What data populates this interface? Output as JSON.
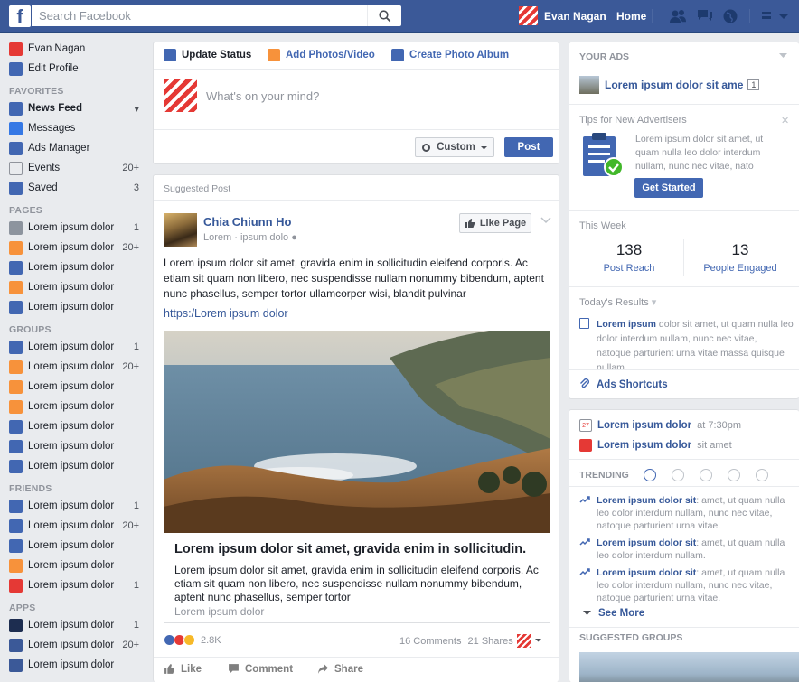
{
  "topbar": {
    "logo": "f",
    "search_placeholder": "Search Facebook",
    "user_name": "Evan Nagan",
    "home_label": "Home"
  },
  "leftnav": {
    "profile": [
      {
        "label": "Evan Nagan",
        "icon": "avatar-icon",
        "color": "#e53935"
      },
      {
        "label": "Edit Profile",
        "icon": "pencil-icon",
        "color": "#4267b2"
      }
    ],
    "sections": [
      {
        "title": "FAVORITES",
        "items": [
          {
            "label": "News Feed",
            "count": "",
            "icon": "news-feed-icon",
            "color": "#4267b2",
            "bold": true,
            "caret": true
          },
          {
            "label": "Messages",
            "count": "",
            "icon": "messages-icon",
            "color": "#3578e5"
          },
          {
            "label": "Ads Manager",
            "count": "",
            "icon": "ads-manager-icon",
            "color": "#4267b2"
          },
          {
            "label": "Events",
            "count": "20+",
            "icon": "calendar-icon",
            "color": "#e9ebee"
          },
          {
            "label": "Saved",
            "count": "3",
            "icon": "bookmark-icon",
            "color": "#4267b2"
          }
        ]
      },
      {
        "title": "PAGES",
        "items": [
          {
            "label": "Lorem ipsum dolor",
            "count": "1",
            "icon": "page-icon",
            "color": "#8d949e"
          },
          {
            "label": "Lorem ipsum dolor",
            "count": "20+",
            "icon": "megaphone-icon",
            "color": "#f7923b"
          },
          {
            "label": "Lorem ipsum dolor",
            "count": "",
            "icon": "thumbs-up-icon",
            "color": "#4267b2"
          },
          {
            "label": "Lorem ipsum dolor",
            "count": "",
            "icon": "plus-page-icon",
            "color": "#f7923b"
          },
          {
            "label": "Lorem ipsum dolor",
            "count": "",
            "icon": "chart-icon",
            "color": "#4267b2"
          }
        ]
      },
      {
        "title": "GROUPS",
        "items": [
          {
            "label": "Lorem ipsum dolor",
            "count": "1",
            "icon": "group-icon",
            "color": "#4267b2"
          },
          {
            "label": "Lorem ipsum dolor",
            "count": "20+",
            "icon": "group-icon",
            "color": "#f7923b"
          },
          {
            "label": "Lorem ipsum dolor",
            "count": "",
            "icon": "group-icon",
            "color": "#f7923b"
          },
          {
            "label": "Lorem ipsum dolor",
            "count": "",
            "icon": "group-icon",
            "color": "#f7923b"
          },
          {
            "label": "Lorem ipsum dolor",
            "count": "",
            "icon": "group-icon",
            "color": "#4267b2"
          },
          {
            "label": "Lorem ipsum dolor",
            "count": "",
            "icon": "group-icon",
            "color": "#4267b2"
          },
          {
            "label": "Lorem ipsum dolor",
            "count": "",
            "icon": "plus-group-icon",
            "color": "#4267b2"
          }
        ]
      },
      {
        "title": "FRIENDS",
        "items": [
          {
            "label": "Lorem ipsum dolor",
            "count": "1",
            "icon": "friends-icon",
            "color": "#4267b2"
          },
          {
            "label": "Lorem ipsum dolor",
            "count": "20+",
            "icon": "star-icon",
            "color": "#4267b2"
          },
          {
            "label": "Lorem ipsum dolor",
            "count": "",
            "icon": "friends-icon",
            "color": "#4267b2"
          },
          {
            "label": "Lorem ipsum dolor",
            "count": "",
            "icon": "home-icon",
            "color": "#f7923b"
          },
          {
            "label": "Lorem ipsum dolor",
            "count": "1",
            "icon": "location-icon",
            "color": "#e53935"
          }
        ]
      },
      {
        "title": "APPS",
        "items": [
          {
            "label": "Lorem ipsum dolor",
            "count": "1",
            "icon": "app-icon",
            "color": "#1d2d50"
          },
          {
            "label": "Lorem ipsum dolor",
            "count": "20+",
            "icon": "app-icon",
            "color": "#3b5998"
          },
          {
            "label": "Lorem ipsum dolor",
            "count": "",
            "icon": "app-icon",
            "color": "#3b5998"
          }
        ]
      }
    ]
  },
  "composer": {
    "tabs": [
      {
        "label": "Update Status",
        "icon": "pencil-icon",
        "color": "#4267b2"
      },
      {
        "label": "Add Photos/Video",
        "icon": "photo-icon",
        "color": "#f7923b"
      },
      {
        "label": "Create Photo Album",
        "icon": "album-icon",
        "color": "#4267b2"
      }
    ],
    "placeholder": "What's on your mind?",
    "audience_label": "Custom",
    "post_label": "Post"
  },
  "post": {
    "label": "Suggested Post",
    "author": "Chia Chiunn Ho",
    "subtitle": "Lorem · ipsum dolo",
    "like_page_label": "Like Page",
    "text": "Lorem ipsum dolor sit amet, gravida enim in sollicitudin eleifend corporis. Ac etiam sit quam non libero, nec suspendisse nullam nonummy bibendum, aptent nunc phasellus, semper tortor ullamcorper wisi, blandit pulvinar",
    "link": "https:/Lorem ipsum dolor",
    "link_title": "Lorem ipsum dolor sit amet, gravida enim in sollicitudin.",
    "link_desc": "Lorem ipsum dolor sit amet, gravida enim in sollicitudin eleifend corporis. Ac etiam sit quam non libero, nec suspendisse nullam nonummy bibendum, aptent nunc phasellus, semper tortor",
    "link_site": "Lorem ipsum dolor",
    "reaction_count": "2.8K",
    "comments": "16 Comments",
    "shares": "21 Shares",
    "actions": {
      "like": "Like",
      "comment": "Comment",
      "share": "Share"
    }
  },
  "ads": {
    "title": "YOUR ADS",
    "ad_title": "Lorem ipsum dolor sit ame",
    "ad_badge": "1",
    "tips_title": "Tips for New Advertisers",
    "tips_text": "Lorem ipsum dolor sit amet, ut quam nulla leo dolor interdum nullam, nunc nec vitae, nato",
    "get_started": "Get Started",
    "week_title": "This Week",
    "metrics": [
      {
        "value": "138",
        "label": "Post Reach"
      },
      {
        "value": "13",
        "label": "People Engaged"
      }
    ],
    "results_title": "Today's Results",
    "results_link": "Lorem ipsum",
    "results_text": " dolor sit amet, ut quam nulla leo dolor interdum nullam, nunc nec vitae, natoque parturient urna vitae massa quisque nullam.",
    "shortcuts": "Ads Shortcuts"
  },
  "events": {
    "items": [
      {
        "name": "Lorem ipsum dolor",
        "meta": "at 7:30pm",
        "icon": "calendar-icon"
      },
      {
        "name": "Lorem ipsum dolor",
        "meta": "sit amet",
        "icon": "gift-icon"
      }
    ],
    "trending_title": "TRENDING",
    "trends": [
      {
        "link": "Lorem ipsum dolor sit",
        "text": ": amet, ut quam nulla leo dolor interdum nullam, nunc nec vitae, natoque parturient urna vitae."
      },
      {
        "link": "Lorem ipsum dolor sit",
        "text": ": amet, ut quam nulla leo dolor interdum nullam."
      },
      {
        "link": "Lorem ipsum dolor sit",
        "text": ": amet, ut quam nulla leo dolor interdum nullam, nunc nec vitae, natoque parturient urna vitae."
      }
    ],
    "see_more": "See More",
    "suggested_groups": "SUGGESTED GROUPS"
  },
  "colors": {
    "brand": "#3b5998",
    "link": "#365899",
    "button": "#4267b2"
  }
}
